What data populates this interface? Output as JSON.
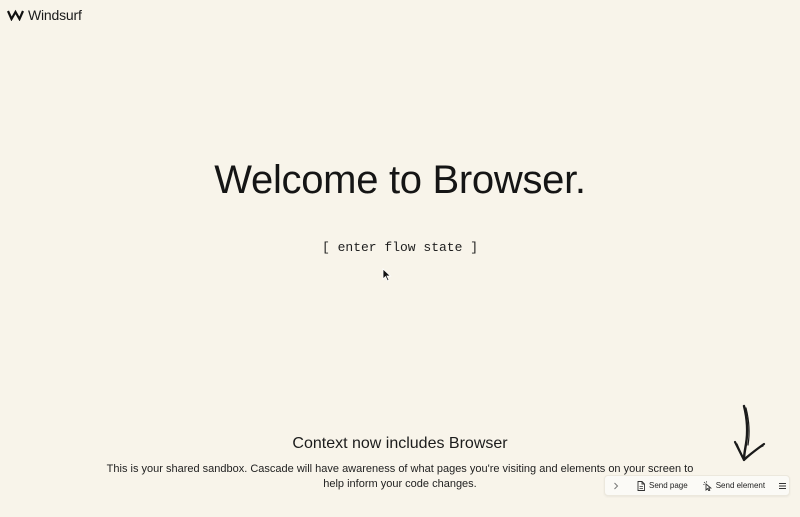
{
  "brand": {
    "name": "Windsurf",
    "logo_icon": "windsurf-wave-icon"
  },
  "hero": {
    "title": "Welcome to Browser.",
    "cta": "[ enter flow state ]"
  },
  "context": {
    "title": "Context now includes Browser",
    "description": "This is your shared sandbox. Cascade will have awareness of what pages you're visiting and elements on your screen to help inform your code changes."
  },
  "toolbar": {
    "collapse_icon": "chevron-right-icon",
    "send_page_label": "Send page",
    "send_page_icon": "page-icon",
    "send_element_label": "Send element",
    "send_element_icon": "pointer-click-icon",
    "menu_icon": "hamburger-menu-icon"
  },
  "decorations": {
    "arrow": "hand-drawn-arrow-down-icon",
    "cursor": "mouse-cursor-icon"
  },
  "colors": {
    "background": "#f8f4ea",
    "text": "#1c1c1c",
    "toolbar_bg": "#fbfaf6"
  }
}
